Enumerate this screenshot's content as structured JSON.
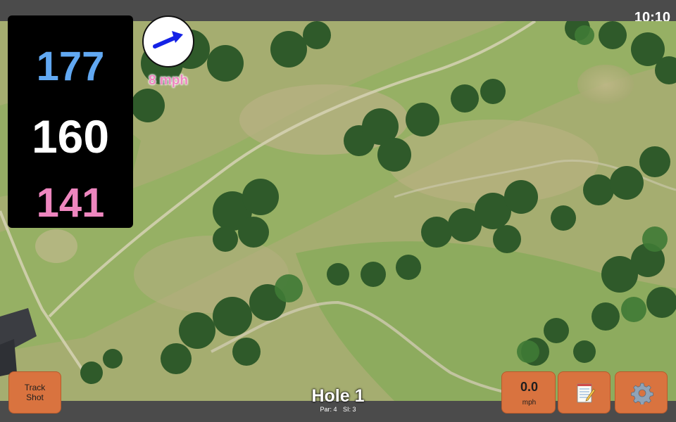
{
  "status": {
    "time": "10:10"
  },
  "distances": {
    "back": "177",
    "middle": "160",
    "front": "141"
  },
  "wind": {
    "speed": "8 mph",
    "direction_icon": "arrow-right-icon"
  },
  "hole": {
    "title": "Hole 1",
    "par": "Par: 4",
    "si": "SI: 3"
  },
  "buttons": {
    "track_line1": "Track",
    "track_line2": "Shot",
    "speed_value": "0.0",
    "speed_unit": "mph",
    "notes_icon": "notepad-icon",
    "settings_icon": "gear-icon"
  },
  "colors": {
    "back": "#61a8f2",
    "middle": "#ffffff",
    "front": "#ee86bf",
    "button": "#d9733f"
  }
}
